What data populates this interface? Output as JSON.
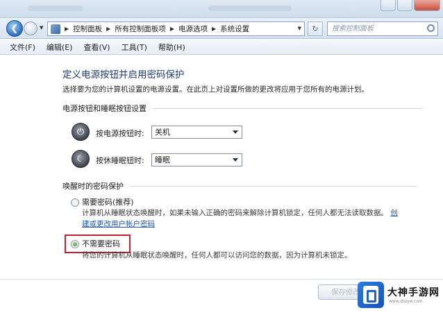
{
  "navigation": {
    "breadcrumbs": [
      "控制面板",
      "所有控制面板项",
      "电源选项",
      "系统设置"
    ],
    "search_placeholder": "搜索控制面板"
  },
  "menu": {
    "items": [
      "文件(F)",
      "编辑(E)",
      "查看(V)",
      "工具(T)",
      "帮助(H)"
    ]
  },
  "page": {
    "title": "定义电源按钮并启用密码保护",
    "description": "选择要为您的计算机设置的电源设置。在此页上对设置所做的更改将应用于您所有的电源计划。"
  },
  "buttons_section": {
    "header": "电源按钮和睡眠按钮设置",
    "power_label": "按电源按钮时:",
    "power_value": "关机",
    "sleep_label": "按休睡眠钮时:",
    "sleep_value": "睡眠"
  },
  "password_section": {
    "header": "唤醒时的密码保护",
    "option_require_label": "需要密码(推荐)",
    "option_require_note": "计算机从睡眠状态唤醒时，如果未输入正确的密码来解除计算机锁定，任何人都无法读取数据。",
    "option_require_link_start": "创",
    "option_require_link": "建或更改用户帐户密码",
    "option_none_label": "不需要密码",
    "option_none_note": "将您的计算机从睡眠状态唤醒时，任何人都可以访问您的数据，因为计算机未锁定。",
    "selected": "option_none"
  },
  "footer": {
    "save_label": "保存修改"
  },
  "watermark": {
    "brand": "大神手游网",
    "url": "www.dssyw.com"
  },
  "colors": {
    "title_blue": "#1e3a78",
    "link_blue": "#1a57b4",
    "highlight_red": "#c71f2d"
  }
}
